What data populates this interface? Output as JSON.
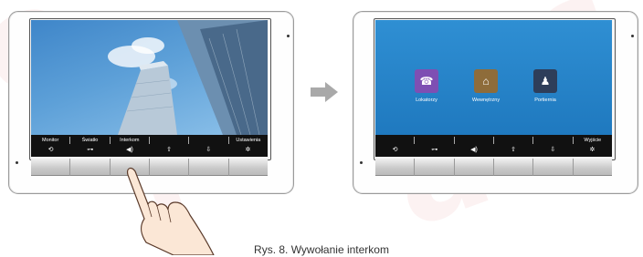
{
  "left_screen": {
    "menu_labels": [
      "Monitor",
      "Światło",
      "Interkom",
      "",
      "",
      "Ustawienia"
    ],
    "function_icons": [
      "camera-return-icon",
      "key-icon",
      "speaker-icon",
      "arrow-up-icon",
      "arrow-down-icon",
      "gear-icon"
    ],
    "function_glyphs": [
      "⟲",
      "⊶",
      "◀)",
      "⇧",
      "⇩",
      "✲"
    ]
  },
  "right_screen": {
    "menu_items": [
      {
        "label": "Lokatorzy",
        "icon": "residents-intercom-icon",
        "color": "#7e4fb3",
        "glyph": "☎"
      },
      {
        "label": "Wewnętrzny",
        "icon": "internal-intercom-icon",
        "color": "#8e6c3a",
        "glyph": "⌂"
      },
      {
        "label": "Portiernia",
        "icon": "concierge-icon",
        "color": "#2e3e5a",
        "glyph": "♟"
      }
    ],
    "menu_labels": [
      "",
      "",
      "",
      "",
      "",
      "Wyjście"
    ],
    "function_icons": [
      "camera-return-icon",
      "key-icon",
      "speaker-icon",
      "arrow-up-icon",
      "arrow-down-icon",
      "gear-icon"
    ],
    "function_glyphs": [
      "⟲",
      "⊶",
      "◀)",
      "⇧",
      "⇩",
      "✲"
    ]
  },
  "caption": "Rys. 8. Wywołanie interkom",
  "colors": {
    "watermark": "#cc1414",
    "menu_bg": "#2f8fd3",
    "bar": "#111111"
  }
}
